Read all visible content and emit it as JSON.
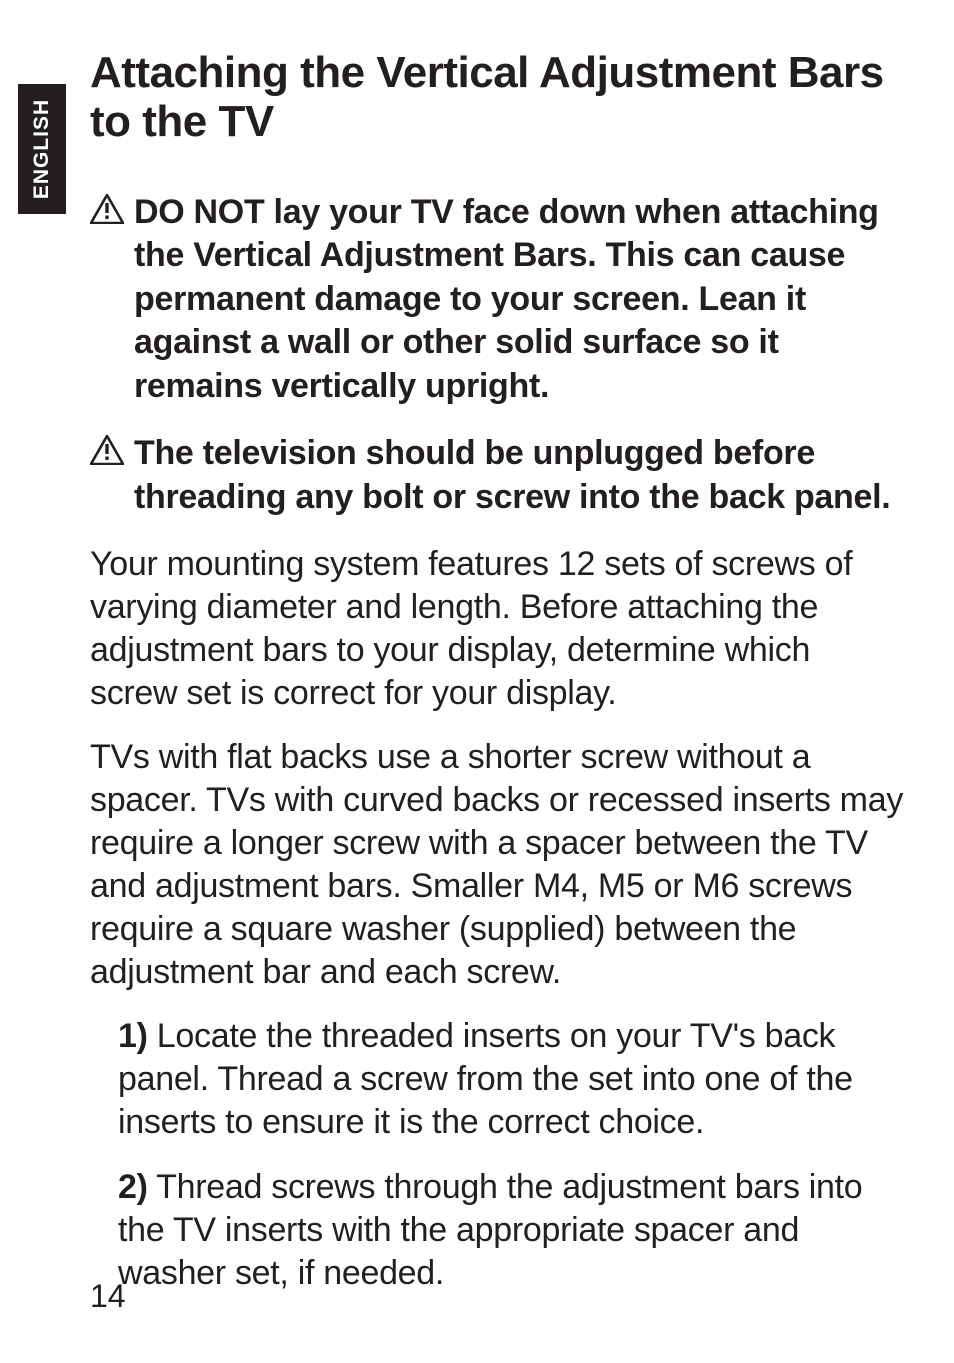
{
  "language_tab": "ENGLISH",
  "heading": "Attaching the Vertical Adjustment Bars to the TV",
  "warnings": [
    "DO NOT lay your TV face down when attaching the Vertical Adjustment Bars. This can cause permanent damage to your screen. Lean it against a wall or other solid surface so it remains vertically upright.",
    "The television should be unplugged before threading any bolt or screw into the back panel."
  ],
  "paragraphs": [
    "Your mounting system features 12 sets of screws of varying diameter and length. Before attaching the adjustment bars to your display, determine which screw set is correct for your display.",
    "TVs with flat backs use a shorter screw without a spacer. TVs with curved backs or recessed inserts may require a longer screw with a spacer between the TV and adjustment bars. Smaller M4, M5 or M6 screws require a square washer (supplied) between the adjustment bar and each screw."
  ],
  "steps": [
    {
      "num": "1)",
      "text": " Locate the threaded inserts on your TV's back panel. Thread a screw from the set into one of the inserts to ensure it is the correct choice."
    },
    {
      "num": "2)",
      "text": " Thread screws through the adjustment bars into the TV inserts with the appropriate spacer and washer set, if needed."
    }
  ],
  "page_number": "14"
}
